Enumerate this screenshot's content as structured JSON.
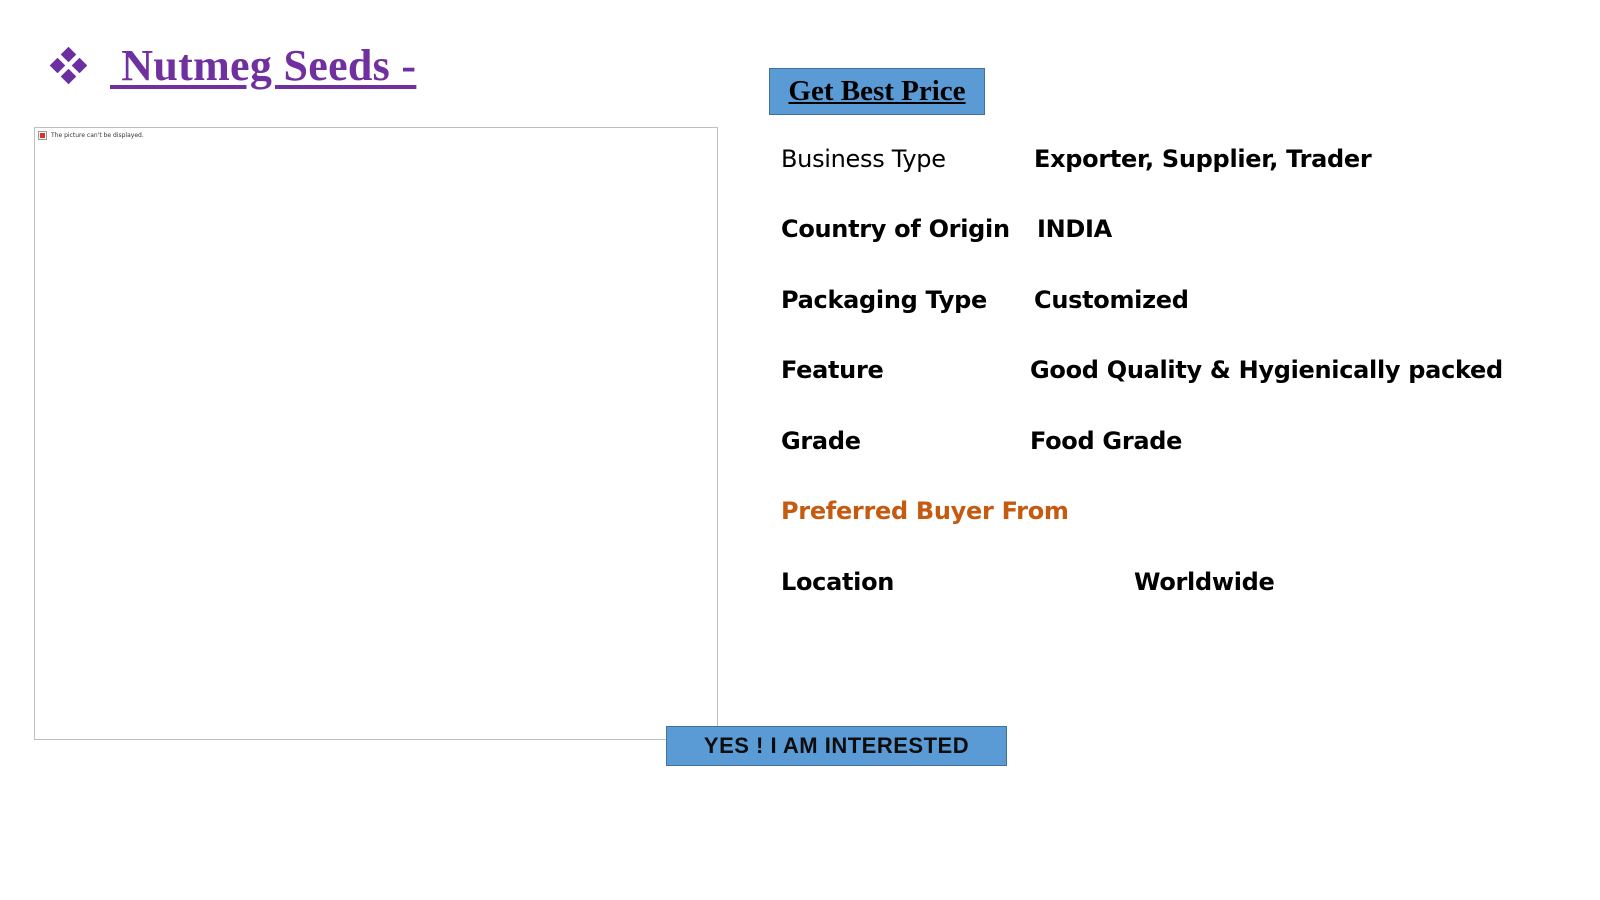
{
  "header": {
    "title": " Nutmeg Seeds -",
    "bullet_icon": "four-diamond-bullet-icon",
    "title_color": "#7030a0"
  },
  "image": {
    "broken_text": "The picture can't be displayed."
  },
  "buttons": {
    "get_best_price": "Get Best Price",
    "interested": "YES ! I AM INTERESTED",
    "accent_color": "#5b9bd5"
  },
  "specs": {
    "business_type": {
      "label": "Business Type",
      "value": "Exporter, Supplier, Trader"
    },
    "country_of_origin": {
      "label": "Country of Origin",
      "value": "INDIA"
    },
    "packaging_type": {
      "label": "Packaging Type",
      "value": "Customized"
    },
    "feature": {
      "label": "Feature",
      "value": "Good Quality & Hygienically packed"
    },
    "grade": {
      "label": "Grade",
      "value": "Food Grade"
    },
    "preferred_buyer_heading": "Preferred Buyer From",
    "location": {
      "label": "Location",
      "value": "Worldwide"
    }
  },
  "colors": {
    "heading_orange": "#c55a11"
  }
}
